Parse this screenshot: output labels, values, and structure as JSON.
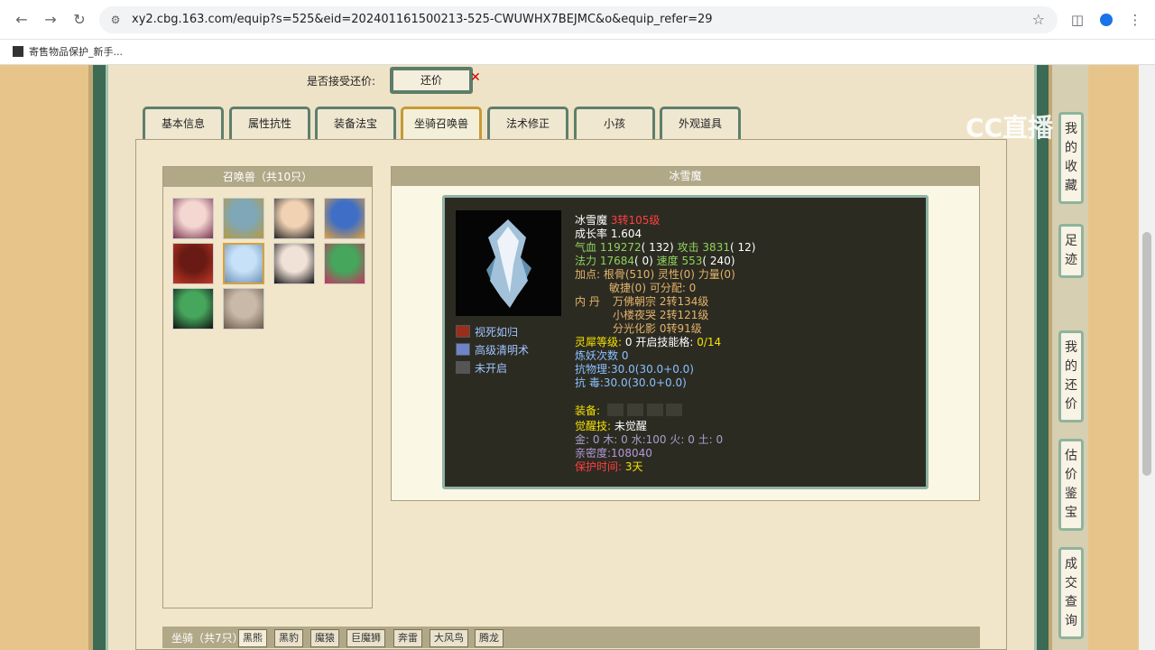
{
  "browser": {
    "url": "xy2.cbg.163.com/equip?s=525&eid=202401161500213-525-CWUWHX7BEJMC&o&equip_refer=29",
    "bookmark": "寄售物品保护_新手..."
  },
  "page": {
    "accept_counter_label": "是否接受还价:",
    "counter_button": "还价",
    "tabs": [
      "基本信息",
      "属性抗性",
      "装备法宝",
      "坐骑召唤兽",
      "法术修正",
      "小孩",
      "外观道具"
    ],
    "active_tab": "坐骑召唤兽",
    "summon_header": "召唤兽（共10只）",
    "pet_name_header": "冰雪魔",
    "skills": [
      {
        "name": "视死如归",
        "icon_color": "#9a2d1c"
      },
      {
        "name": "高级清明术",
        "icon_color": "#6d84c8"
      },
      {
        "name": "未开启",
        "icon_color": "#555555"
      }
    ],
    "stats": {
      "name": "冰雪魔",
      "level": "3转105级",
      "growth": "成长率 1.604",
      "hp_label": "气血",
      "hp": "119272",
      "hp_extra": "( 132)",
      "atk_label": "攻击",
      "atk": "3831",
      "atk_extra": "( 12)",
      "mp_label": "法力",
      "mp": "17684",
      "mp_extra": "( 0)",
      "spd_label": "速度",
      "spd": "553",
      "spd_extra": "( 240)",
      "points_line1": "加点:  根骨(510) 灵性(0) 力量(0)",
      "points_line2": "敏捷(0) 可分配:  0",
      "dan_label": "内   丹",
      "dan1": "万佛朝宗 2转134级",
      "dan2": "小楼夜哭 2转121级",
      "dan3": "分光化影 0转91级",
      "linxi_label": "灵犀等级:",
      "linxi_value": "0 开启技能格:",
      "linxi_slots": "0/14",
      "refine": "炼妖次数 0",
      "resist_phys_label": "抗物理:",
      "resist_phys": "30.0(30.0+0.0)",
      "resist_poison_label": "抗   毒:",
      "resist_poison": "30.0(30.0+0.0)",
      "equip_label": "装备:",
      "awaken_label": "觉醒技:",
      "awaken_value": "未觉醒",
      "elements": "金: 0 木: 0 水:100 火: 0 土: 0",
      "intimacy": "亲密度:108040",
      "protect_label": "保护时间:",
      "protect_value": "3天"
    },
    "mount_label": "坐骑（共7只）",
    "mount_tabs": [
      "黑熊",
      "黑豹",
      "魔猿",
      "巨魔狮",
      "奔雷",
      "大风鸟",
      "腾龙"
    ],
    "right_sidebar": [
      "我的收藏",
      "足迹",
      "我的还价",
      "估价鉴宝",
      "成交查询"
    ]
  },
  "pets": [
    {
      "colors": [
        "#f4d7d1",
        "#7a3350"
      ]
    },
    {
      "colors": [
        "#7fa7b7",
        "#b89a3e"
      ]
    },
    {
      "colors": [
        "#f1d2b3",
        "#222222"
      ]
    },
    {
      "colors": [
        "#3e6ec6",
        "#e4a13a"
      ]
    },
    {
      "colors": [
        "#6a1a14",
        "#c13a25"
      ]
    },
    {
      "colors": [
        "#c6e1f8",
        "#6d8fb4"
      ]
    },
    {
      "colors": [
        "#f1e2d8",
        "#111111"
      ]
    },
    {
      "colors": [
        "#45a65c",
        "#c9325e"
      ]
    },
    {
      "colors": [
        "#45a65c",
        "#111111"
      ]
    },
    {
      "colors": [
        "#c9b9a8",
        "#6b5a4a"
      ]
    }
  ],
  "logo_text": "CC直播"
}
